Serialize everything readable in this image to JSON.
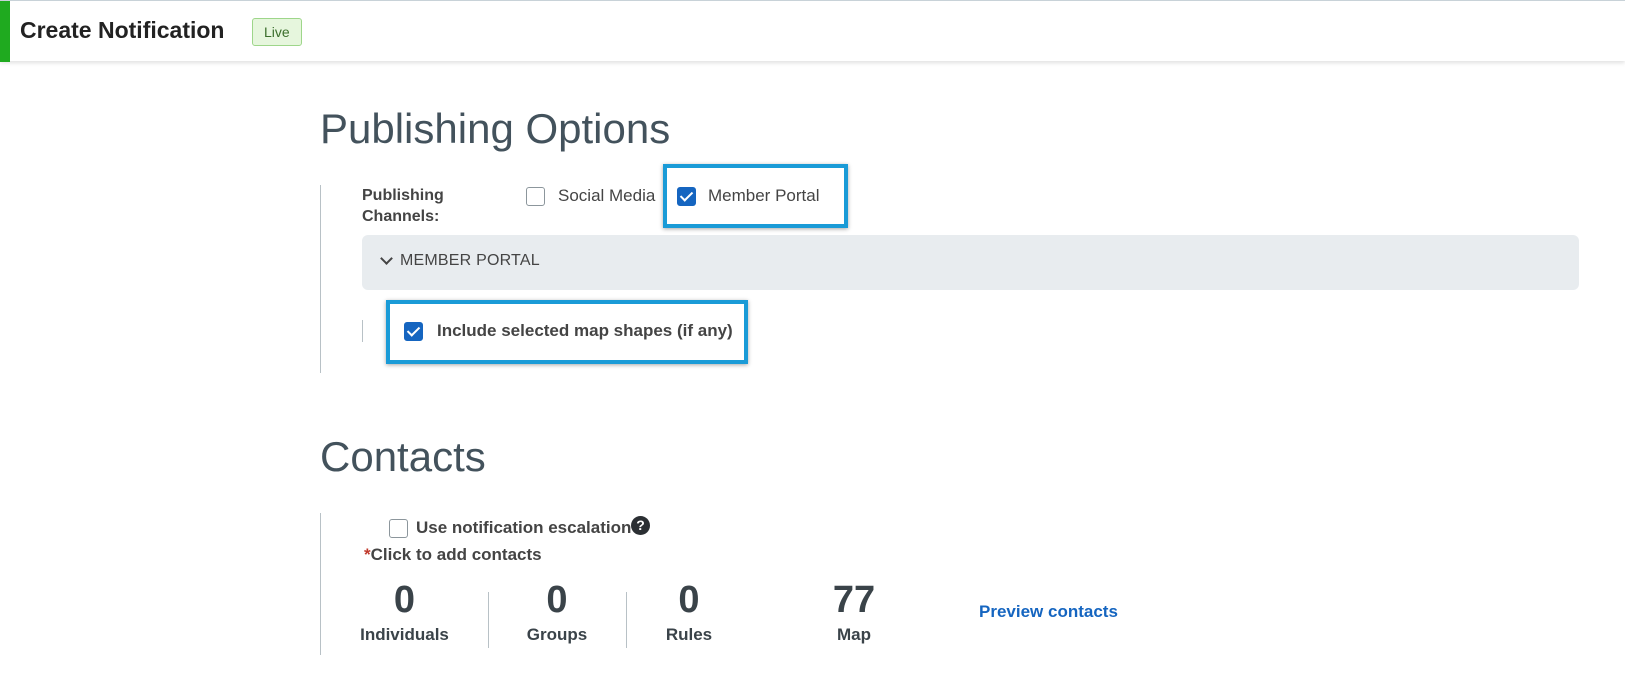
{
  "header": {
    "title": "Create Notification",
    "badge": "Live"
  },
  "publishing": {
    "heading": "Publishing Options",
    "channels_label": "Publishing Channels:",
    "options": [
      {
        "label": "Social Media",
        "checked": false
      },
      {
        "label": "Member Portal",
        "checked": true
      }
    ],
    "panel_title": "MEMBER PORTAL",
    "include_shapes_label": "Include selected map shapes (if any)",
    "include_shapes_checked": true
  },
  "contacts": {
    "heading": "Contacts",
    "escalation_label": "Use notification escalation",
    "escalation_checked": false,
    "help_icon": "question-circle-icon",
    "required_marker": "*",
    "add_contacts_label": "Click to add contacts",
    "stats": [
      {
        "value": "0",
        "label": "Individuals"
      },
      {
        "value": "0",
        "label": "Groups"
      },
      {
        "value": "0",
        "label": "Rules"
      },
      {
        "value": "77",
        "label": "Map"
      }
    ],
    "preview_link": "Preview contacts"
  },
  "colors": {
    "accent_green": "#1faa1f",
    "highlight_blue": "#1a9bd7",
    "link_blue": "#1565c0"
  }
}
